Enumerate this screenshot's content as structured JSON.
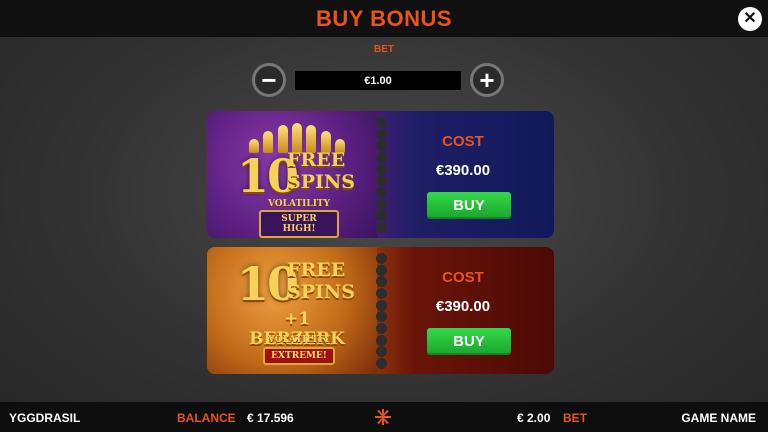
{
  "header": {
    "title": "BUY BONUS",
    "close_icon": "close-icon"
  },
  "bet_selector": {
    "label": "BET",
    "value": "€1.00",
    "minus_icon": "minus-icon",
    "plus_icon": "plus-icon"
  },
  "offers": [
    {
      "count": "10",
      "line1": "FREE",
      "line2": "SPINS",
      "extra": "",
      "volatility_label": "VOLATILITY",
      "volatility_value": "SUPER HIGH!",
      "cost_label": "COST",
      "cost_value": "€390.00",
      "buy_label": "BUY"
    },
    {
      "count": "10",
      "line1": "FREE",
      "line2": "SPINS",
      "extra": "+1 BERZERK",
      "volatility_label": "VOLATILITY",
      "volatility_value": "EXTREME!",
      "cost_label": "COST",
      "cost_value": "€390.00",
      "buy_label": "BUY"
    }
  ],
  "footer": {
    "brand": "YGGDRASIL",
    "balance_label": "BALANCE",
    "balance_value": "€ 17.596",
    "bet_value": "€ 2.00",
    "bet_label": "BET",
    "game_name": "GAME NAME"
  },
  "colors": {
    "accent": "#e8531e",
    "buy_button": "#1fb734",
    "topbar": "#101010"
  }
}
